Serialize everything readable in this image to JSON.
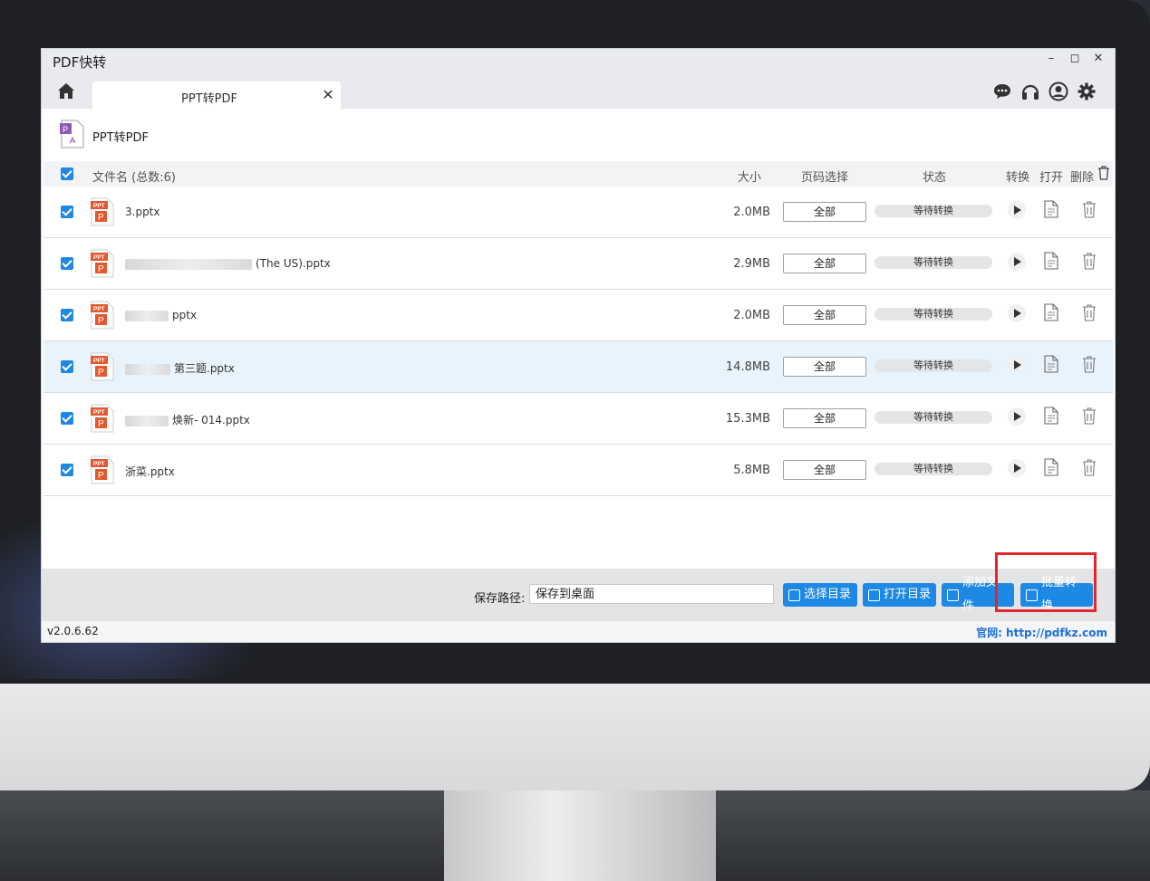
{
  "colors": {
    "accent": "#1e88e5",
    "highlight_box": "#e3262b",
    "row_highlight": "#e8f3fc"
  },
  "window": {
    "title": "PDF快转",
    "controls": [
      "–",
      "◻",
      "✕"
    ]
  },
  "tabs": [
    {
      "label": "PPT转PDF",
      "close": "✕"
    }
  ],
  "top_icons": [
    "chat-icon",
    "headset-icon",
    "user-icon",
    "settings-icon"
  ],
  "page": {
    "title": "PPT转PDF",
    "icon": "ppt-to-pdf-icon"
  },
  "table": {
    "headers": {
      "filename": "文件名 (总数:6)",
      "size": "大小",
      "pages": "页码选择",
      "status": "状态",
      "convert": "转换",
      "open": "打开",
      "delete": "删除"
    },
    "rows": [
      {
        "name_pre": "",
        "name": "3.pptx",
        "size": "2.0MB",
        "pages": "全部",
        "status": "等待转换",
        "highlight": false
      },
      {
        "name_pre": "blur-wide",
        "name": "(The US).pptx",
        "size": "2.9MB",
        "pages": "全部",
        "status": "等待转换",
        "highlight": false
      },
      {
        "name_pre": "blur-short",
        "name": "pptx",
        "size": "2.0MB",
        "pages": "全部",
        "status": "等待转换",
        "highlight": false
      },
      {
        "name_pre": "blur-mid",
        "name": "第三题.pptx",
        "size": "14.8MB",
        "pages": "全部",
        "status": "等待转换",
        "highlight": true
      },
      {
        "name_pre": "blur-short",
        "name": "焕新- 014.pptx",
        "size": "15.3MB",
        "pages": "全部",
        "status": "等待转换",
        "highlight": false
      },
      {
        "name_pre": "",
        "name": "浙菜.pptx",
        "size": "5.8MB",
        "pages": "全部",
        "status": "等待转换",
        "highlight": false
      }
    ]
  },
  "bottom": {
    "path_label": "保存路径:",
    "path_value": "保存到桌面",
    "buttons": {
      "select_dir": "选择目录",
      "open_dir": "打开目录",
      "add_file": "添加文件",
      "batch_convert": "批量转换"
    }
  },
  "statusbar": {
    "version": "v2.0.6.62",
    "website": "官网: http://pdfkz.com"
  }
}
